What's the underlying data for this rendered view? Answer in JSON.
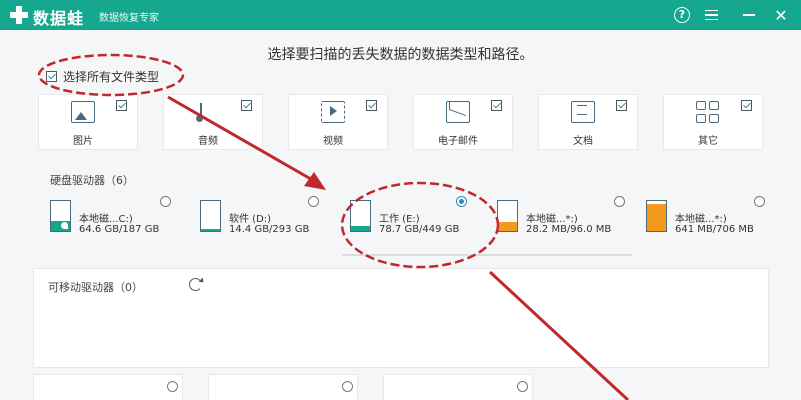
{
  "app": {
    "name": "数据蛙",
    "subtitle": "数据恢复专家"
  },
  "window_controls": [
    "help-icon",
    "menu-icon",
    "minimize-icon",
    "close-icon"
  ],
  "main": {
    "title": "选择要扫描的丢失数据的数据类型和路径。"
  },
  "select_all": {
    "label": "选择所有文件类型",
    "checked": true
  },
  "file_types": [
    {
      "label": "图片",
      "icon": "image-icon",
      "checked": true
    },
    {
      "label": "音频",
      "icon": "audio-icon",
      "checked": true
    },
    {
      "label": "视频",
      "icon": "video-icon",
      "checked": true
    },
    {
      "label": "电子邮件",
      "icon": "mail-icon",
      "checked": true
    },
    {
      "label": "文档",
      "icon": "document-icon",
      "checked": true
    },
    {
      "label": "其它",
      "icon": "other-icon",
      "checked": true
    }
  ],
  "hard_drives": {
    "header": "硬盘驱动器（6）",
    "items": [
      {
        "name": "本地磁...C:)",
        "size": "64.6 GB/187 GB",
        "selected": false,
        "fill_fraction": 0.35,
        "fill_color": "#15a88f"
      },
      {
        "name": "软件 (D:)",
        "size": "14.4 GB/293 GB",
        "selected": false,
        "fill_fraction": 0.05,
        "fill_color": "#15a88f"
      },
      {
        "name": "工作 (E:)",
        "size": "78.7 GB/449 GB",
        "selected": true,
        "fill_fraction": 0.18,
        "fill_color": "#15a88f"
      },
      {
        "name": "本地磁...*:)",
        "size": "28.2 MB/96.0 MB",
        "selected": false,
        "fill_fraction": 0.29,
        "fill_color": "#f39a1e"
      },
      {
        "name": "本地磁...*:)",
        "size": "641 MB/706 MB",
        "selected": false,
        "fill_fraction": 0.91,
        "fill_color": "#f39a1e"
      }
    ]
  },
  "removable": {
    "header": "可移动驱动器（0）"
  },
  "colors": {
    "brand": "#15a88f",
    "accent": "#2a8fbe",
    "annotation": "#c0282d",
    "warning": "#f39a1e"
  }
}
